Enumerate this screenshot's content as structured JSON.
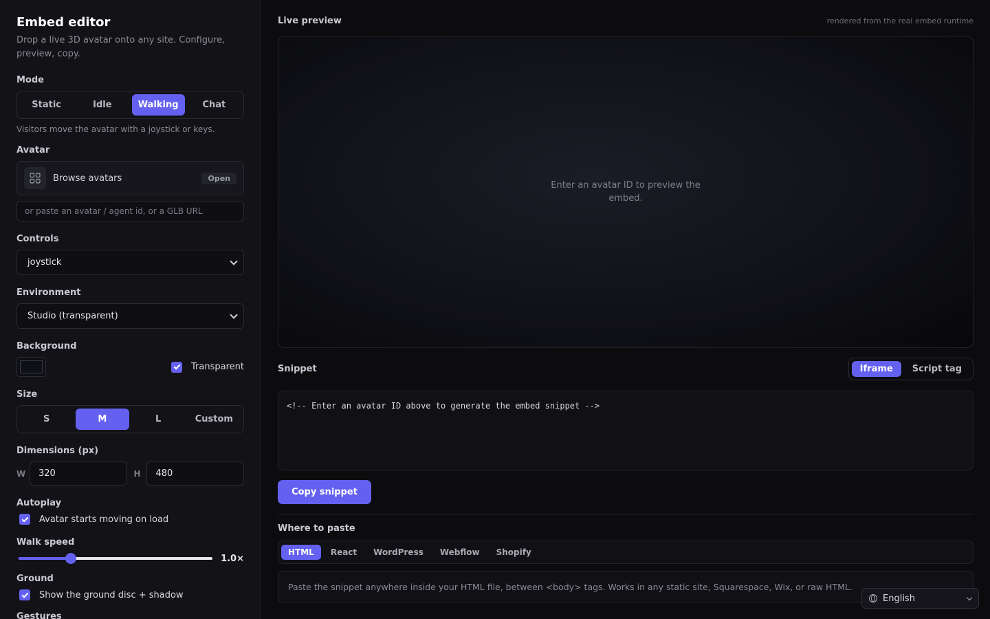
{
  "sidebar": {
    "title": "Embed editor",
    "subtitle": "Drop a live 3D avatar onto any site. Configure, preview, copy.",
    "mode": {
      "label": "Mode",
      "options": [
        "Static",
        "Idle",
        "Walking",
        "Chat"
      ],
      "selected": "Walking",
      "hint": "Visitors move the avatar with a joystick or keys."
    },
    "avatar": {
      "label": "Avatar",
      "browse_label": "Browse avatars",
      "open_badge": "Open",
      "input_placeholder": "or paste an avatar / agent id, or a GLB URL"
    },
    "controls": {
      "label": "Controls",
      "value": "joystick"
    },
    "environment": {
      "label": "Environment",
      "value": "Studio (transparent)"
    },
    "background": {
      "label": "Background",
      "color": "#0d1117",
      "transparent_label": "Transparent",
      "transparent_checked": true
    },
    "size": {
      "label": "Size",
      "options": [
        "S",
        "M",
        "L",
        "Custom"
      ],
      "selected": "M"
    },
    "dimensions": {
      "label": "Dimensions (px)",
      "w_label": "W",
      "w_value": "320",
      "h_label": "H",
      "h_value": "480"
    },
    "autoplay": {
      "label": "Autoplay",
      "checkbox_label": "Avatar starts moving on load",
      "checked": true
    },
    "walk_speed": {
      "label": "Walk speed",
      "value_text": "1.0×",
      "level": 0.27
    },
    "ground": {
      "label": "Ground",
      "checkbox_label": "Show the ground disc + shadow",
      "checked": true
    },
    "gestures": {
      "label": "Gestures"
    }
  },
  "main": {
    "preview": {
      "title": "Live preview",
      "note": "rendered from the real embed runtime",
      "empty_message": "Enter an avatar ID to preview the embed."
    },
    "snippet": {
      "title": "Snippet",
      "tabs": [
        "Iframe",
        "Script tag"
      ],
      "selected_tab": "Iframe",
      "code": "<!-- Enter an avatar ID above to generate the embed snippet -->",
      "copy_label": "Copy snippet"
    },
    "paste": {
      "title": "Where to paste",
      "platforms": [
        "HTML",
        "React",
        "WordPress",
        "Webflow",
        "Shopify"
      ],
      "selected": "HTML",
      "note": "Paste the snippet anywhere inside your HTML file, between <body> tags. Works in any static site, Squarespace, Wix, or raw HTML."
    }
  },
  "language": {
    "value": "English"
  },
  "colors": {
    "accent": "#6461f0",
    "background": "#0c0c0f",
    "sidebar": "#121217"
  }
}
